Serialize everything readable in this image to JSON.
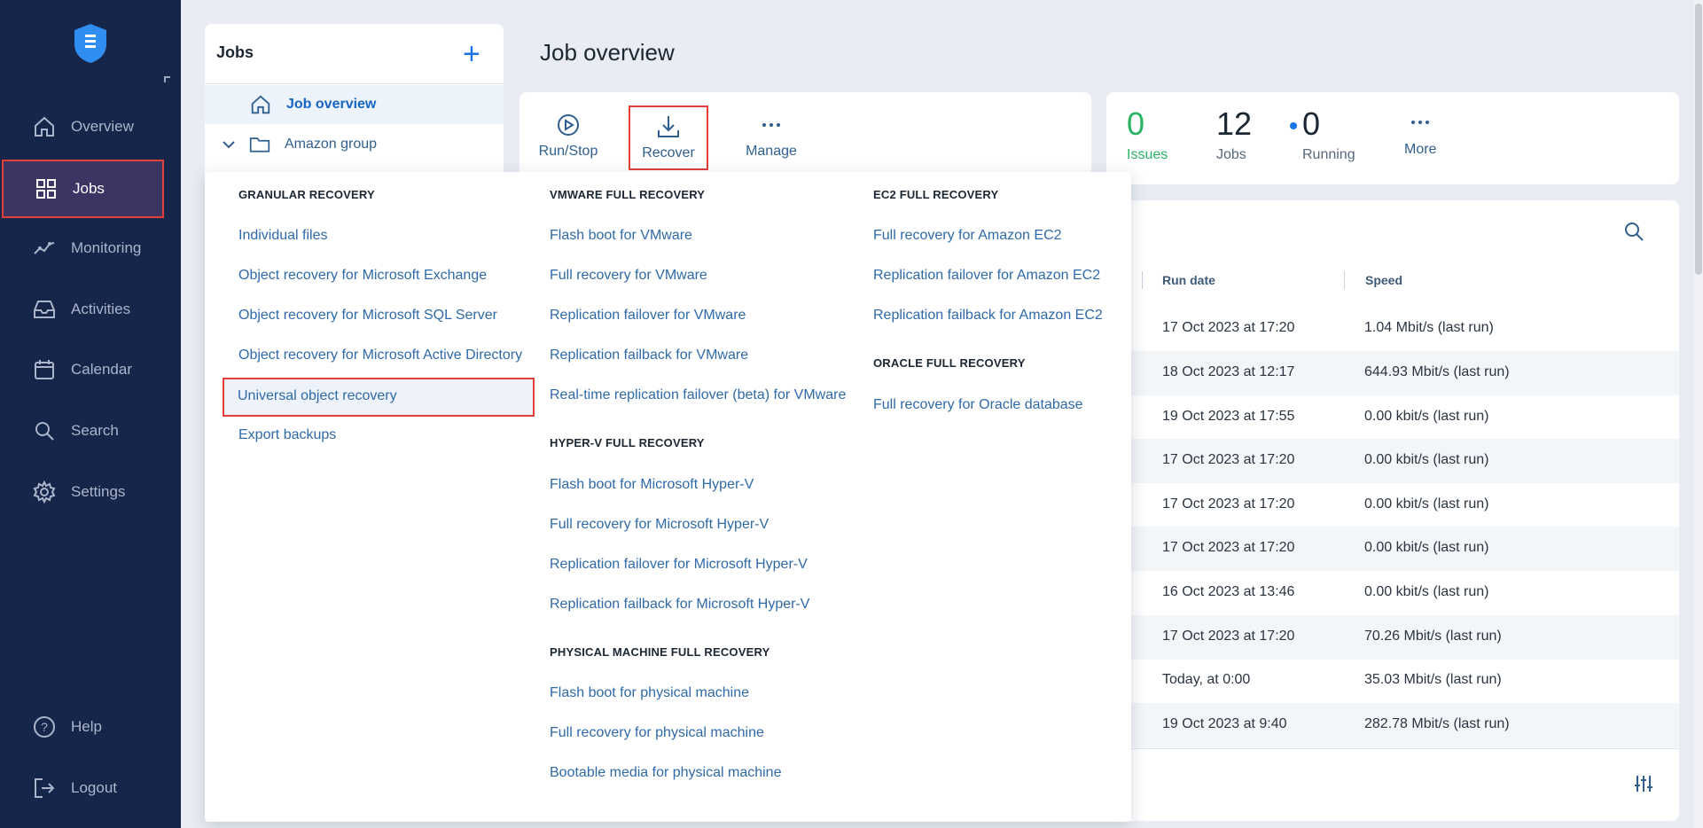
{
  "sidebar": {
    "items": [
      {
        "label": "Overview",
        "icon": "home-icon"
      },
      {
        "label": "Jobs",
        "icon": "grid-icon"
      },
      {
        "label": "Monitoring",
        "icon": "chart-line-icon"
      },
      {
        "label": "Activities",
        "icon": "inbox-icon"
      },
      {
        "label": "Calendar",
        "icon": "calendar-icon"
      },
      {
        "label": "Search",
        "icon": "search-icon"
      },
      {
        "label": "Settings",
        "icon": "gear-icon"
      }
    ],
    "bottom": [
      {
        "label": "Help",
        "icon": "help-icon"
      },
      {
        "label": "Logout",
        "icon": "logout-icon"
      }
    ],
    "active_index": 1,
    "colors": {
      "background": "#16264a",
      "active": "#3a3562",
      "highlight_border": "#e3403a"
    }
  },
  "jobs_panel": {
    "title": "Jobs",
    "add_label": "+",
    "tree": [
      {
        "label": "Job overview",
        "selected": true
      },
      {
        "label": "Amazon group",
        "selected": false
      }
    ]
  },
  "page": {
    "title": "Job overview"
  },
  "toolbar": {
    "run_stop": "Run/Stop",
    "recover": "Recover",
    "manage": "Manage"
  },
  "stats": {
    "issues_value": "0",
    "issues_label": "Issues",
    "jobs_value": "12",
    "jobs_label": "Jobs",
    "running_value": "0",
    "running_label": "Running",
    "more_label": "More"
  },
  "table": {
    "headers": {
      "run_date": "Run date",
      "speed": "Speed"
    },
    "rows": [
      {
        "run_date": "17 Oct 2023 at 17:20",
        "speed": "1.04 Mbit/s (last run)"
      },
      {
        "run_date": "18 Oct 2023 at 12:17",
        "speed": "644.93 Mbit/s (last run)"
      },
      {
        "run_date": "19 Oct 2023 at 17:55",
        "speed": "0.00 kbit/s (last run)"
      },
      {
        "run_date": "17 Oct 2023 at 17:20",
        "speed": "0.00 kbit/s (last run)"
      },
      {
        "run_date": "17 Oct 2023 at 17:20",
        "speed": "0.00 kbit/s (last run)"
      },
      {
        "run_date": "17 Oct 2023 at 17:20",
        "speed": "0.00 kbit/s (last run)"
      },
      {
        "run_date": "16 Oct 2023 at 13:46",
        "speed": "0.00 kbit/s (last run)"
      },
      {
        "run_date": "17 Oct 2023 at 17:20",
        "speed": "70.26 Mbit/s (last run)"
      },
      {
        "run_date": "Today, at 0:00",
        "speed": "35.03 Mbit/s (last run)"
      },
      {
        "run_date": "19 Oct 2023 at 9:40",
        "speed": "282.78 Mbit/s (last run)"
      }
    ]
  },
  "recover_menu": {
    "granular": {
      "heading": "GRANULAR RECOVERY",
      "items": [
        "Individual files",
        "Object recovery for Microsoft Exchange",
        "Object recovery for Microsoft SQL Server",
        "Object recovery for Microsoft Active Directory",
        "Universal object recovery",
        "Export backups"
      ]
    },
    "vmware": {
      "heading": "VMWARE FULL RECOVERY",
      "items": [
        "Flash boot for VMware",
        "Full recovery for VMware",
        "Replication failover for VMware",
        "Replication failback for VMware",
        "Real-time replication failover (beta) for VMware"
      ]
    },
    "hyperv": {
      "heading": "HYPER-V FULL RECOVERY",
      "items": [
        "Flash boot for Microsoft Hyper-V",
        "Full recovery for Microsoft Hyper-V",
        "Replication failover for Microsoft Hyper-V",
        "Replication failback for Microsoft Hyper-V"
      ]
    },
    "physical": {
      "heading": "PHYSICAL MACHINE FULL RECOVERY",
      "items": [
        "Flash boot for physical machine",
        "Full recovery for physical machine",
        "Bootable media for physical machine"
      ]
    },
    "ec2": {
      "heading": "EC2 FULL RECOVERY",
      "items": [
        "Full recovery for Amazon EC2",
        "Replication failover for Amazon EC2",
        "Replication failback for Amazon EC2"
      ]
    },
    "oracle": {
      "heading": "ORACLE FULL RECOVERY",
      "items": [
        "Full recovery for Oracle database"
      ]
    }
  }
}
